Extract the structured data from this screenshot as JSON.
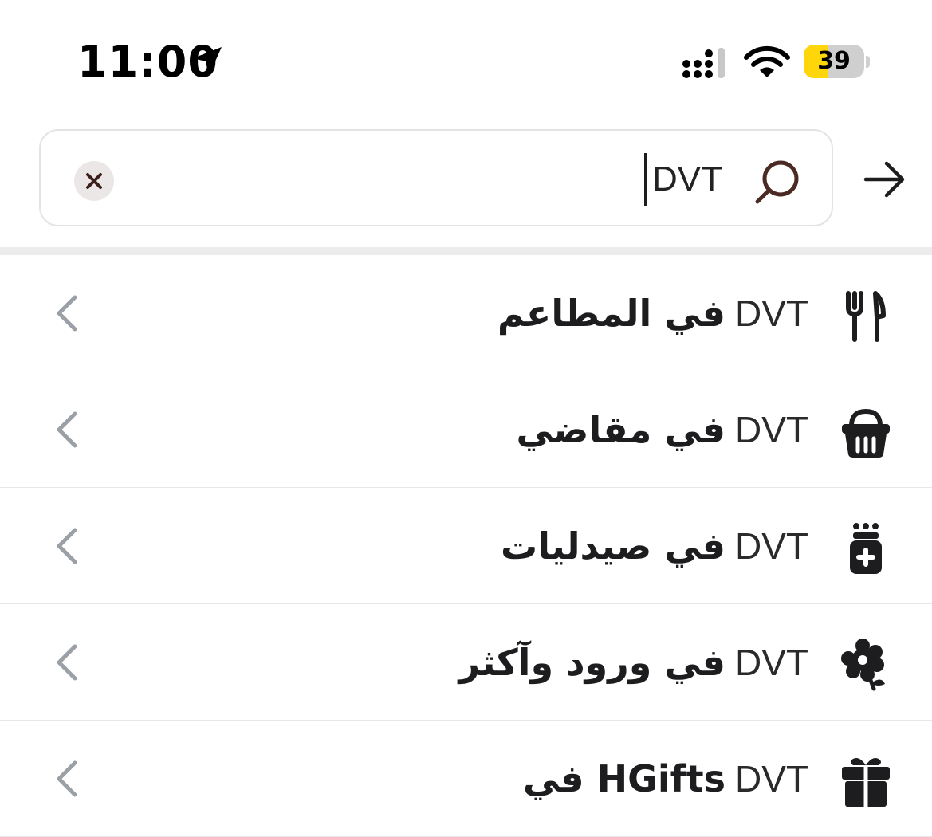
{
  "status_bar": {
    "time": "11:00",
    "battery_percent": 39,
    "battery_label": "39",
    "battery_color": "#ffd60a",
    "icons": [
      "location-arrow-icon",
      "signal-icon",
      "wifi-icon",
      "battery-icon"
    ]
  },
  "search": {
    "value": "DVT",
    "icons": {
      "search": "search-icon",
      "clear": "close-icon",
      "back": "arrow-right-icon"
    }
  },
  "results": [
    {
      "latin": "DVT",
      "arabic": "في المطاعم",
      "icon": "fork-knife-icon"
    },
    {
      "latin": "DVT",
      "arabic": "في مقاضي",
      "icon": "basket-icon"
    },
    {
      "latin": "DVT",
      "arabic": "في صيدليات",
      "icon": "medicine-bottle-icon"
    },
    {
      "latin": "DVT",
      "arabic": "في ورود وآكثر",
      "icon": "flower-icon"
    },
    {
      "latin": "DVT",
      "arabic": "في HGifts",
      "icon": "gift-icon"
    }
  ],
  "colors": {
    "accent_cursor": "#1d1d1f",
    "chevron": "#9aa0a6",
    "search_icon": "#4a2a22"
  }
}
